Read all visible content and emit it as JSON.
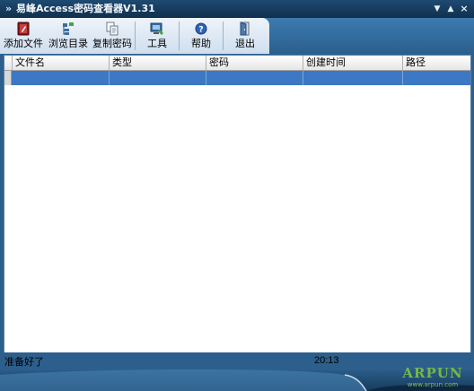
{
  "window": {
    "title": "易峰Access密码查看器V1.31"
  },
  "icons": {
    "title": "chevron-right-icon",
    "minimize": "down-arrow-icon",
    "maximize": "up-arrow-icon",
    "close": "close-icon"
  },
  "toolbar": {
    "buttons": [
      {
        "label": "添加文件",
        "icon": "add-file-icon"
      },
      {
        "label": "浏览目录",
        "icon": "browse-folder-icon"
      },
      {
        "label": "复制密码",
        "icon": "copy-icon"
      },
      {
        "label": "工具",
        "icon": "tools-icon"
      },
      {
        "label": "帮助",
        "icon": "help-icon"
      },
      {
        "label": "退出",
        "icon": "exit-door-icon"
      }
    ]
  },
  "table": {
    "columns": [
      "文件名",
      "类型",
      "密码",
      "创建时间",
      "路径"
    ],
    "rows": [
      [
        "",
        "",
        "",
        "",
        ""
      ]
    ],
    "selected_row": 0
  },
  "status": {
    "text": "准备好了",
    "time": "20:13"
  },
  "watermark": {
    "brand": "ARPUN",
    "subtext": "www.arpun.com"
  },
  "colors": {
    "frame": "#2c5f8c",
    "title_bar": "#10304d",
    "selection": "#3c78c4",
    "watermark": "#7fc243"
  }
}
